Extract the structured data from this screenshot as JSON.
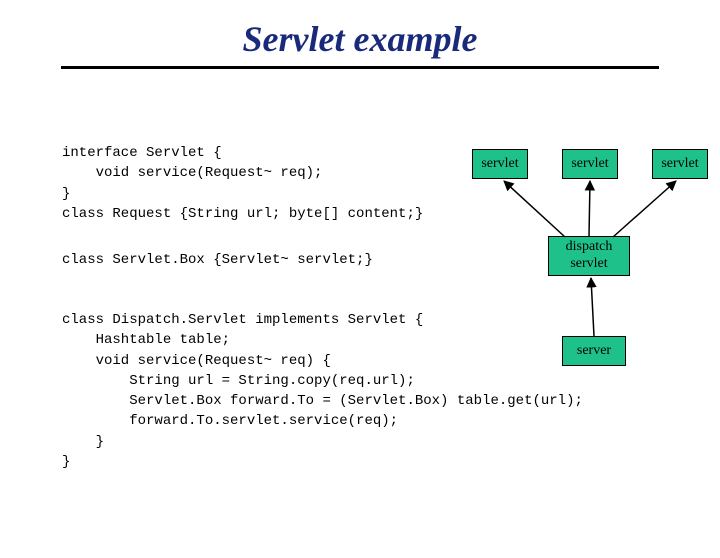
{
  "title": "Servlet example",
  "code_block_1": "interface Servlet {\n    void service(Request~ req);\n}\nclass Request {String url; byte[] content;}",
  "code_block_2": "class Servlet.Box {Servlet~ servlet;}",
  "code_block_3": "class Dispatch.Servlet implements Servlet {\n    Hashtable table;\n    void service(Request~ req) {\n        String url = String.copy(req.url);\n        Servlet.Box forward.To = (Servlet.Box) table.get(url);\n        forward.To.servlet.service(req);\n    }\n}",
  "boxes": {
    "servlet1": "servlet",
    "servlet2": "servlet",
    "servlet3": "servlet",
    "dispatch": "dispatch\nservlet",
    "server": "server"
  }
}
